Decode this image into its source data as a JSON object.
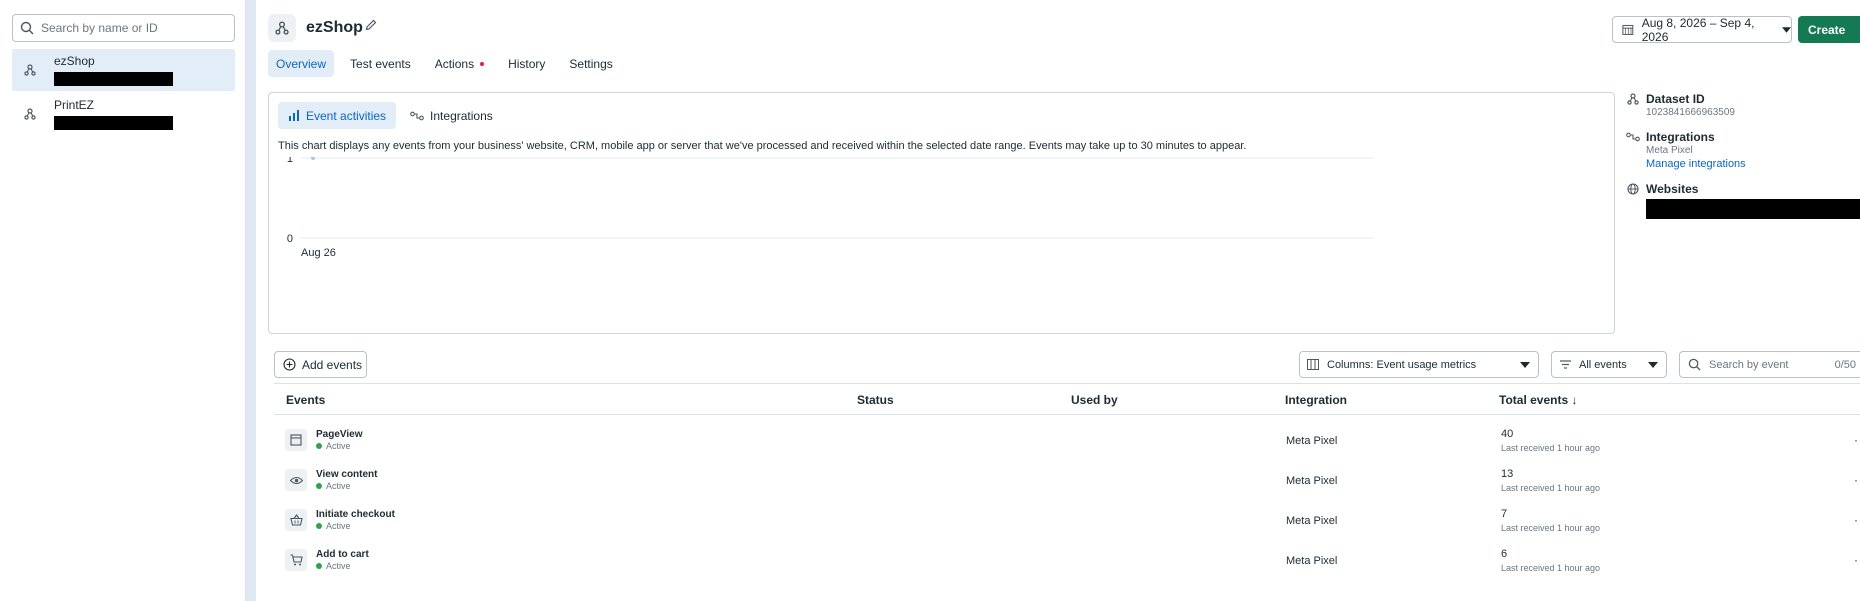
{
  "sidebar": {
    "search_placeholder": "Search by name or ID",
    "datasets": [
      {
        "name": "ezShop"
      },
      {
        "name": "PrintEZ"
      }
    ]
  },
  "header": {
    "title": "ezShop",
    "date_range": "Aug 8, 2026 – Sep 4, 2026",
    "create_label": "Create",
    "tabs": [
      {
        "label": "Overview"
      },
      {
        "label": "Test events"
      },
      {
        "label": "Actions"
      },
      {
        "label": "History"
      },
      {
        "label": "Settings"
      }
    ]
  },
  "chart_card": {
    "tabs": [
      {
        "label": "Event activities"
      },
      {
        "label": "Integrations"
      }
    ],
    "description": "This chart displays any events from your business' website, CRM, mobile app or server that we've processed and received within the selected date range. Events may take up to 30 minutes to appear."
  },
  "chart_data": {
    "type": "line",
    "x": [
      "Aug 26"
    ],
    "series": [
      {
        "values": [
          1
        ]
      }
    ],
    "y_ticks": [
      "1",
      "0"
    ],
    "ylim": [
      0,
      1
    ],
    "xlabel": "",
    "ylabel": "",
    "grid": true,
    "color": "#a8c8ef"
  },
  "info": {
    "dataset_id_label": "Dataset ID",
    "dataset_id": "1023841666963509",
    "integrations_label": "Integrations",
    "integrations_value": "Meta Pixel",
    "manage_link": "Manage integrations",
    "websites_label": "Websites"
  },
  "toolbar": {
    "add_events": "Add events",
    "columns": "Columns: Event usage metrics",
    "filter": "All events",
    "search_placeholder": "Search by event",
    "search_count": "0/50"
  },
  "table": {
    "headers": {
      "events": "Events",
      "status": "Status",
      "used_by": "Used by",
      "integration": "Integration",
      "total": "Total events ↓"
    },
    "rows": [
      {
        "name": "PageView",
        "status": "Active",
        "integration": "Meta Pixel",
        "total": "40",
        "last": "Last received 1 hour ago",
        "icon": "page-icon"
      },
      {
        "name": "View content",
        "status": "Active",
        "integration": "Meta Pixel",
        "total": "13",
        "last": "Last received 1 hour ago",
        "icon": "eye-icon"
      },
      {
        "name": "Initiate checkout",
        "status": "Active",
        "integration": "Meta Pixel",
        "total": "7",
        "last": "Last received 1 hour ago",
        "icon": "basket-icon"
      },
      {
        "name": "Add to cart",
        "status": "Active",
        "integration": "Meta Pixel",
        "total": "6",
        "last": "Last received 1 hour ago",
        "icon": "cart-icon"
      }
    ]
  },
  "colors": {
    "accent": "#0a66c2",
    "create_button": "#147a53",
    "active_dot": "#31a24c",
    "actions_badge": "#e41e3f"
  }
}
